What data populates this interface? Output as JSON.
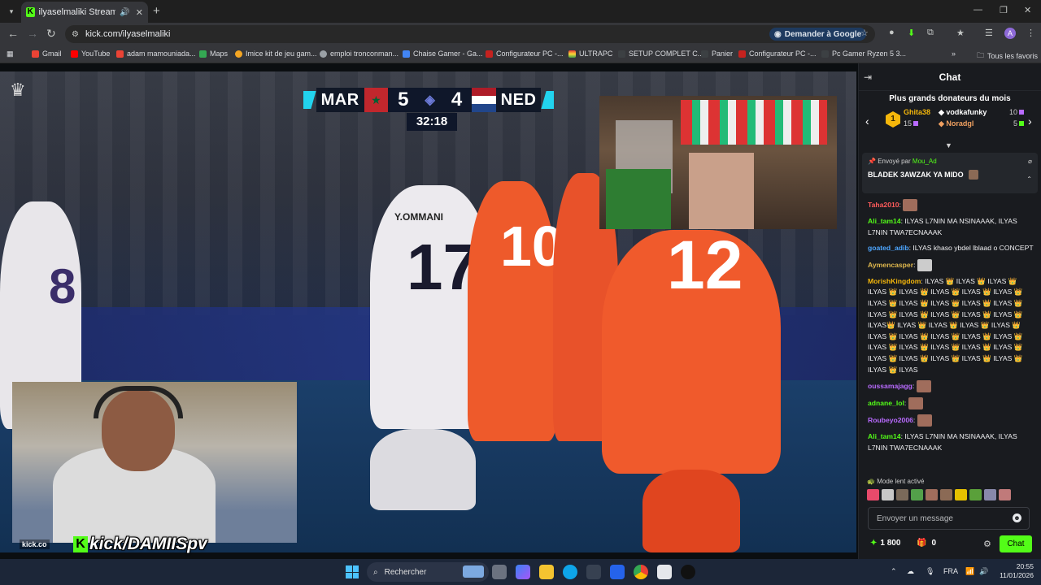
{
  "browser": {
    "tab_title": "ilyaselmaliki Stream - Watch",
    "url": "kick.com/ilyaselmaliki",
    "google_button": "Demander à Google",
    "avatar_letter": "A",
    "bookmarks": [
      "Gmail",
      "YouTube",
      "adam mamouniada...",
      "Maps",
      "Imice kit de jeu gam...",
      "emploi tronconman...",
      "Chaise Gamer - Ga...",
      "Configurateur PC -...",
      "ULTRAPC",
      "SETUP COMPLET C...",
      "Panier",
      "Configurateur PC -...",
      "Pc Gamer Ryzen 5 3...",
      "Tous les favoris"
    ]
  },
  "video": {
    "team_home": "MAR",
    "score_home": "5",
    "score_away": "4",
    "team_away": "NED",
    "match_time": "32:18",
    "overlay_handle": "kick/DAMIISpv",
    "overlay_small": "kick.co",
    "jersey_17_name": "Y.OMMANI",
    "jersey_17": "17",
    "jersey_10": "10",
    "jersey_12": "12",
    "jersey_8": "8"
  },
  "chat": {
    "title": "Chat",
    "donors_title": "Plus grands donateurs du mois",
    "donors": [
      {
        "rank": "1",
        "name": "Ghita38",
        "amount": "15",
        "color": "#f5b70b"
      },
      {
        "name": "vodkafunky",
        "amount": "10",
        "color": "#ffffff"
      },
      {
        "name": "Noradgl",
        "amount": "5",
        "color": "#f0a060"
      }
    ],
    "pinned_by_label": "Envoyé par",
    "pinned_by_user": "Mou_Ad",
    "pinned_message": "BLADEK 3AWZAK YA MIDO",
    "messages": [
      {
        "user": "Taha2010",
        "color": "#ff5b5b",
        "text": ""
      },
      {
        "user": "Ali_tam14",
        "color": "#53fc18",
        "text": "ILYAS L7NIN MA NSINAAAK, ILYAS L7NIN TWA7ECNAAAK"
      },
      {
        "user": "goated_adib",
        "color": "#4da6ff",
        "text": "ILYAS khaso ybdel lblaad o CONCEPT"
      },
      {
        "user": "Aymencasper",
        "color": "#e0b84d",
        "text": ""
      },
      {
        "user": "MorishKingdom",
        "color": "#f5b70b",
        "text": "ILYAS 👑 ILYAS 👑 ILYAS 👑 ILYAS 👑 ILYAS 👑 ILYAS 👑 ILYAS 👑 ILYAS 👑 ILYAS 👑 ILYAS 👑 ILYAS 👑 ILYAS 👑 ILYAS 👑 ILYAS 👑 ILYAS 👑 ILYAS 👑 ILYAS 👑 ILYAS 👑 ILYAS👑 ILYAS 👑 ILYAS 👑 ILYAS 👑 ILYAS 👑 ILYAS 👑 ILYAS 👑 ILYAS 👑 ILYAS 👑 ILYAS 👑 ILYAS 👑 ILYAS 👑 ILYAS 👑 ILYAS 👑 ILYAS 👑 ILYAS 👑 ILYAS 👑 ILYAS 👑 ILYAS 👑 ILYAS 👑 ILYAS 👑 ILYAS"
      },
      {
        "user": "oussamajagg",
        "color": "#b96bff",
        "text": ""
      },
      {
        "user": "adnane_lol",
        "color": "#53fc18",
        "text": ""
      },
      {
        "user": "Roubeyo2006",
        "color": "#b96bff",
        "text": ""
      },
      {
        "user": "Ali_tam14",
        "color": "#53fc18",
        "text": "ILYAS L7NIN MA NSINAAAK, ILYAS L7NIN TWA7ECNAAAK"
      }
    ],
    "slow_mode": "Mode lent activé",
    "input_placeholder": "Envoyer un message",
    "points": "1 800",
    "gift_count": "0",
    "chat_button": "Chat"
  },
  "taskbar": {
    "search": "Rechercher",
    "lang": "FRA",
    "time": "20:55",
    "date": "11/01/2026"
  },
  "colors": {
    "kick_green": "#53fc18",
    "chat_bg": "#191b1f",
    "scoreboard_accent": "#22d3ee"
  }
}
